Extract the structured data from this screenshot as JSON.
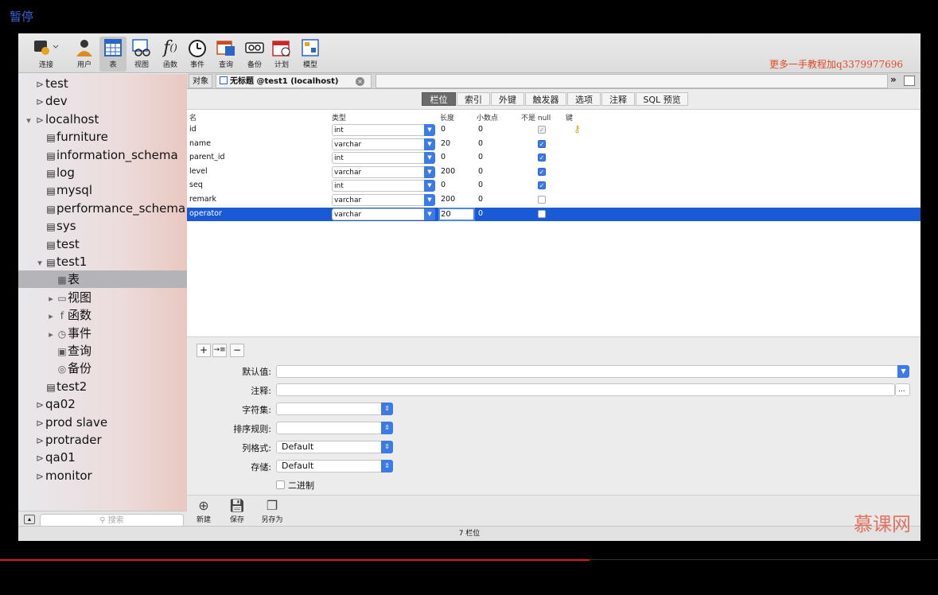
{
  "overlay": {
    "pause_label": "暂停",
    "watermark": "更多一手教程加q3379977696",
    "logo_text": "慕课网"
  },
  "toolbar": {
    "items": [
      {
        "label": "连接",
        "icon": "connection-icon"
      },
      {
        "label": "用户",
        "icon": "user-icon"
      },
      {
        "label": "表",
        "icon": "table-icon"
      },
      {
        "label": "视图",
        "icon": "view-icon"
      },
      {
        "label": "函数",
        "icon": "function-icon"
      },
      {
        "label": "事件",
        "icon": "event-icon"
      },
      {
        "label": "查询",
        "icon": "query-icon"
      },
      {
        "label": "备份",
        "icon": "backup-icon"
      },
      {
        "label": "计划",
        "icon": "schedule-icon"
      },
      {
        "label": "模型",
        "icon": "model-icon"
      }
    ],
    "active": "表"
  },
  "sidebar": {
    "items": [
      {
        "label": "test",
        "icon": "connection-icon"
      },
      {
        "label": "dev",
        "icon": "connection-icon"
      },
      {
        "label": "localhost",
        "icon": "connection-icon",
        "expanded": true
      },
      {
        "label": "furniture",
        "icon": "database-icon"
      },
      {
        "label": "information_schema",
        "icon": "database-icon"
      },
      {
        "label": "log",
        "icon": "database-icon"
      },
      {
        "label": "mysql",
        "icon": "database-icon"
      },
      {
        "label": "performance_schema",
        "icon": "database-icon"
      },
      {
        "label": "sys",
        "icon": "database-icon"
      },
      {
        "label": "test",
        "icon": "database-icon"
      },
      {
        "label": "test1",
        "icon": "database-icon",
        "expanded": true
      },
      {
        "label": "表",
        "icon": "table-icon",
        "selected": true
      },
      {
        "label": "视图",
        "icon": "view-icon"
      },
      {
        "label": "函数",
        "icon": "function-icon"
      },
      {
        "label": "事件",
        "icon": "event-icon"
      },
      {
        "label": "查询",
        "icon": "query-icon"
      },
      {
        "label": "备份",
        "icon": "backup-icon"
      },
      {
        "label": "test2",
        "icon": "database-icon"
      },
      {
        "label": "qa02",
        "icon": "connection-icon"
      },
      {
        "label": "prod slave",
        "icon": "connection-icon"
      },
      {
        "label": "protrader",
        "icon": "connection-icon"
      },
      {
        "label": "qa01",
        "icon": "connection-icon"
      },
      {
        "label": "monitor",
        "icon": "connection-icon"
      }
    ],
    "search_placeholder": "搜索"
  },
  "tabs": {
    "objects": "对象",
    "current": "无标题 @test1 (localhost)"
  },
  "subtabs": [
    "栏位",
    "索引",
    "外键",
    "触发器",
    "选项",
    "注释",
    "SQL 预览"
  ],
  "grid": {
    "headers": [
      "名",
      "类型",
      "长度",
      "小数点",
      "不是 null",
      "键"
    ],
    "rows": [
      {
        "name": "id",
        "type": "int",
        "length": "0",
        "decimal": "0",
        "not_null": "dim",
        "key": true
      },
      {
        "name": "name",
        "type": "varchar",
        "length": "20",
        "decimal": "0",
        "not_null": "on",
        "key": false
      },
      {
        "name": "parent_id",
        "type": "int",
        "length": "0",
        "decimal": "0",
        "not_null": "on",
        "key": false
      },
      {
        "name": "level",
        "type": "varchar",
        "length": "200",
        "decimal": "0",
        "not_null": "on",
        "key": false
      },
      {
        "name": "seq",
        "type": "int",
        "length": "0",
        "decimal": "0",
        "not_null": "on",
        "key": false
      },
      {
        "name": "remark",
        "type": "varchar",
        "length": "200",
        "decimal": "0",
        "not_null": "off",
        "key": false
      },
      {
        "name": "operator",
        "type": "varchar",
        "length": "20",
        "decimal": "0",
        "not_null": "off",
        "key": false,
        "selected": true
      }
    ]
  },
  "props": {
    "default_label": "默认值:",
    "comment_label": "注释:",
    "charset_label": "字符集:",
    "collation_label": "排序规则:",
    "rowformat_label": "列格式:",
    "rowformat_value": "Default",
    "storage_label": "存储:",
    "storage_value": "Default",
    "binary_label": "二进制",
    "ellipsis": "..."
  },
  "actions": [
    {
      "label": "新建",
      "icon": "new-icon"
    },
    {
      "label": "保存",
      "icon": "save-icon"
    },
    {
      "label": "另存为",
      "icon": "save-as-icon"
    }
  ],
  "status": "7 栏位",
  "colors": {
    "accent": "#3c7be6",
    "selection": "#1a5ad6",
    "progress": "#e01c1c"
  }
}
